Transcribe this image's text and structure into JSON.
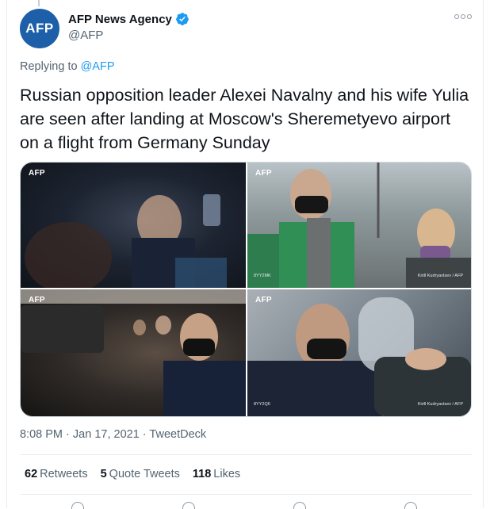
{
  "account": {
    "avatar_text": "AFP",
    "display_name": "AFP News Agency",
    "handle": "@AFP",
    "verified": true
  },
  "reply": {
    "prefix": "Replying to",
    "to_handle": "@AFP"
  },
  "tweet": {
    "text": "Russian opposition leader Alexei Navalny and his wife Yulia are seen after landing at Moscow's Sheremetyevo airport on a flight from Germany Sunday"
  },
  "media": {
    "photos": [
      {
        "logo": "AFP",
        "credit_left": "",
        "credit_right": ""
      },
      {
        "logo": "AFP",
        "credit_left": "8YY2MK",
        "credit_right": "Kirill Kudryavtsev / AFP"
      },
      {
        "logo": "AFP",
        "credit_left": "",
        "credit_right": ""
      },
      {
        "logo": "AFP",
        "credit_left": "8YY2Q6",
        "credit_right": "Kirill Kudryavtsev / AFP"
      }
    ]
  },
  "meta": {
    "time": "8:08 PM",
    "separator": "·",
    "date": "Jan 17, 2021",
    "source": "TweetDeck"
  },
  "stats": {
    "retweets_count": "62",
    "retweets_label": "Retweets",
    "quotes_count": "5",
    "quotes_label": "Quote Tweets",
    "likes_count": "118",
    "likes_label": "Likes"
  },
  "colors": {
    "accent": "#1d9bf0",
    "secondary_text": "#536471",
    "avatar_bg": "#1d5fa8"
  },
  "icons": [
    "verified-badge-icon",
    "more-options-icon",
    "reply-icon",
    "retweet-icon",
    "like-icon",
    "share-icon"
  ]
}
